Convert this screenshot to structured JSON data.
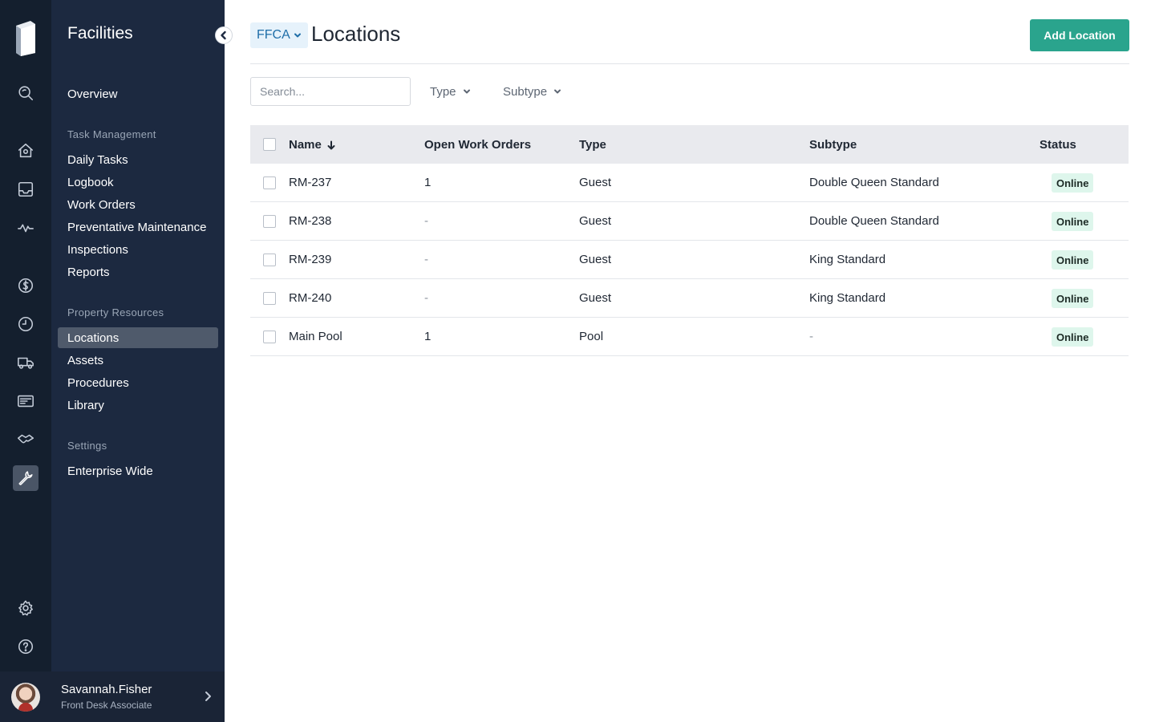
{
  "rail": {
    "icons": [
      "logo-icon",
      "search-icon",
      "home-icon",
      "inbox-icon",
      "activity-icon",
      "dollar-icon",
      "clock-icon",
      "truck-icon",
      "ticket-icon",
      "handshake-icon",
      "wrench-icon",
      "gear-icon",
      "help-icon"
    ]
  },
  "sidebar": {
    "title": "Facilities",
    "overview": "Overview",
    "task_section": "Task Management",
    "task_items": [
      "Daily Tasks",
      "Logbook",
      "Work Orders",
      "Preventative Maintenance",
      "Inspections",
      "Reports"
    ],
    "property_section": "Property Resources",
    "property_items": [
      "Locations",
      "Assets",
      "Procedures",
      "Library"
    ],
    "settings_section": "Settings",
    "settings_items": [
      "Enterprise Wide"
    ]
  },
  "user": {
    "name": "Savannah.Fisher",
    "role": "Front Desk Associate"
  },
  "header": {
    "org": "FFCA",
    "title": "Locations",
    "add_label": "Add Location"
  },
  "filters": {
    "search_placeholder": "Search...",
    "type_label": "Type",
    "subtype_label": "Subtype"
  },
  "table": {
    "columns": [
      "Name",
      "Open Work Orders",
      "Type",
      "Subtype",
      "Status"
    ],
    "rows": [
      {
        "name": "RM-237",
        "open": "1",
        "type": "Guest",
        "subtype": "Double Queen Standard",
        "status": "Online"
      },
      {
        "name": "RM-238",
        "open": "-",
        "type": "Guest",
        "subtype": "Double Queen Standard",
        "status": "Online"
      },
      {
        "name": "RM-239",
        "open": "-",
        "type": "Guest",
        "subtype": "King Standard",
        "status": "Online"
      },
      {
        "name": "RM-240",
        "open": "-",
        "type": "Guest",
        "subtype": "King Standard",
        "status": "Online"
      },
      {
        "name": "Main Pool",
        "open": "1",
        "type": "Pool",
        "subtype": "-",
        "status": "Online"
      }
    ]
  },
  "colors": {
    "rail_bg": "#141f2e",
    "panel_bg": "#1c2940",
    "accent": "#2aa48d",
    "status_online_bg": "#def6ec",
    "org_chip_text": "#1f6ea8"
  }
}
